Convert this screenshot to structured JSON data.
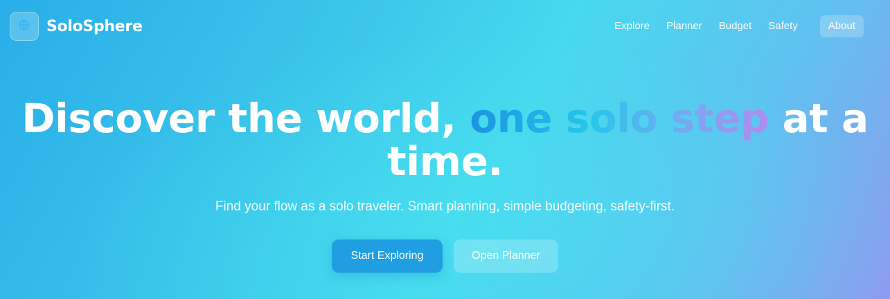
{
  "brand": {
    "name": "SoloSphere",
    "logo_icon": "globe-icon"
  },
  "nav": {
    "links": [
      "Explore",
      "Planner",
      "Budget",
      "Safety"
    ],
    "about": "About"
  },
  "hero": {
    "headline_start": "Discover the world, ",
    "headline_highlight": "one solo step",
    "headline_end": " at a time.",
    "subtitle": "Find your flow as a solo traveler. Smart planning, simple budgeting, safety-first.",
    "primary_cta": "Start Exploring",
    "secondary_cta": "Open Planner"
  },
  "colors": {
    "accent": "#1f9fe2",
    "gradient_start": "#29aee8",
    "gradient_end": "#8e9bf0"
  }
}
